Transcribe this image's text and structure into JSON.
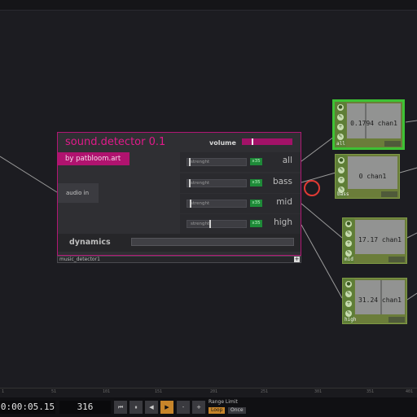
{
  "component": {
    "title": "sound.detector 0.1",
    "volume_label": "volume",
    "by_label": "by patbloom.art",
    "audio_in_label": "audio in",
    "bands": [
      {
        "slider_label": "strenght",
        "multiplier": "x35",
        "name": "all"
      },
      {
        "slider_label": "strenght",
        "multiplier": "x35",
        "name": "bass"
      },
      {
        "slider_label": "strenght",
        "multiplier": "x35",
        "name": "mid"
      },
      {
        "slider_label": "strenght",
        "multiplier": "x35",
        "name": "high"
      }
    ],
    "dynamics_label": "dynamics",
    "operator_name": "music_detector1",
    "footer_plus": "+"
  },
  "nodes": [
    {
      "name": "all",
      "value": "0.1794 chan1"
    },
    {
      "name": "bass",
      "value": "0 chan1"
    },
    {
      "name": "mid",
      "value": "17.17 chan1"
    },
    {
      "name": "high",
      "value": "31.24 chan1"
    }
  ],
  "timeline": {
    "ticks": [
      "1",
      "51",
      "101",
      "151",
      "201",
      "251",
      "301",
      "351",
      "401"
    ]
  },
  "transport": {
    "timecode": "0:00:05.15",
    "frame": "316",
    "buttons": [
      "⏮",
      "⏸",
      "◀",
      "▶",
      "-",
      "+"
    ],
    "range_limit_label": "Range Limit",
    "loop_label": "Loop",
    "once_label": "Once"
  },
  "colors": {
    "accent": "#b0136f",
    "node_green": "#6b7d3a",
    "active_border": "#3ec234",
    "play_orange": "#c7852a"
  }
}
